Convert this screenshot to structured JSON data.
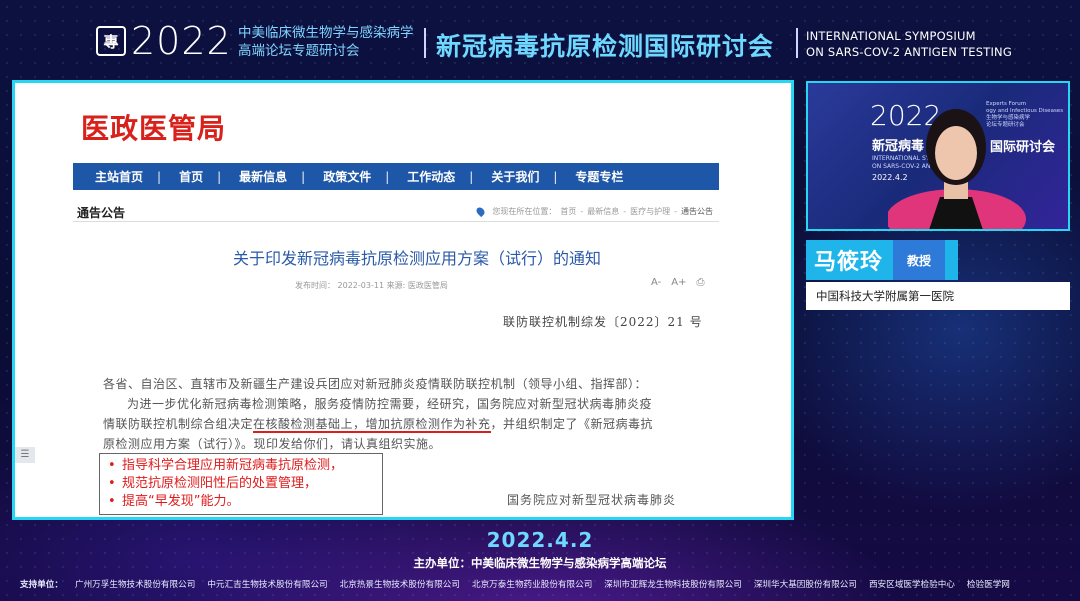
{
  "header": {
    "logo_glyph": "專",
    "year": "2022",
    "subtitle_line1": "中美临床微生物学与感染病学",
    "subtitle_line2": "高端论坛专题研讨会",
    "title": "新冠病毒抗原检测国际研讨会",
    "en_line1": "INTERNATIONAL SYMPOSIUM",
    "en_line2": "ON SARS-COV-2 ANTIGEN TESTING"
  },
  "slide": {
    "org_name": "医政医管局",
    "nav": [
      "主站首页",
      "首页",
      "最新信息",
      "政策文件",
      "工作动态",
      "关于我们",
      "专题专栏"
    ],
    "section_heading": "通告公告",
    "breadcrumb": [
      "您现在所在位置：",
      "首页",
      "最新信息",
      "医疗与护理",
      "通告公告"
    ],
    "article_title": "关于印发新冠病毒抗原检测应用方案（试行）的通知",
    "meta": "发布时间：  2022-03-11    来源: 医政医管局",
    "tools": [
      "A-",
      "A+",
      "⎙"
    ],
    "doc_number": "联防联控机制综发〔2022〕21 号",
    "para_addressee": "各省、自治区、直辖市及新疆生产建设兵团应对新冠肺炎疫情联防联控机制（领导小组、指挥部）：",
    "para_line1": "为进一步优化新冠病毒检测策略，服务疫情防控需要，经研究，国务院应对新型冠状病毒肺炎疫",
    "para_line2_pre": "情联防联控机制综合组决定",
    "para_line2_highlight": "在核酸检测基础上，增加抗原检测作为补充",
    "para_line2_post": "，并组织制定了《新冠病毒抗",
    "para_line3": "原检测应用方案（试行）》。现印发给你们，请认真组织实施。",
    "signer": "国务院应对新型冠状病毒肺炎",
    "bullets": [
      "指导科学合理应用新冠病毒抗原检测，",
      "规范抗原检测阳性后的处置管理，",
      "提高“早发现”能力。"
    ],
    "side_tab": "☰"
  },
  "video": {
    "year": "2022",
    "title_left": "新冠病毒",
    "title_right": "国际研讨会",
    "en_line1": "INTERNATIONAL SYMPOSI",
    "en_line2": "ON SARS-COV-2 ANTIGEN",
    "date": "2022.4.2",
    "small_line1": "Experts Forum",
    "small_line2": "ogy and Infectious Diseases",
    "small_line3": "生物学与感染病学",
    "small_line4": "论坛专题研讨会"
  },
  "speaker": {
    "name": "马筱玲",
    "role": "教授",
    "affiliation": "中国科技大学附属第一医院"
  },
  "footer": {
    "date": "2022.4.2",
    "host_label": "主办单位：",
    "host": "中美临床微生物学与感染病学高端论坛",
    "support_label": "支持单位：",
    "supporters": [
      "广州万孚生物技术股份有限公司",
      "中元汇吉生物技术股份有限公司",
      "北京热景生物技术股份有限公司",
      "北京万泰生物药业股份有限公司",
      "深圳市亚辉龙生物科技股份有限公司",
      "深圳华大基因股份有限公司",
      "西安区域医学检验中心",
      "检验医学网"
    ]
  },
  "colors": {
    "accent_cyan": "#27d6f2",
    "title_cyan": "#6fd8ff",
    "red": "#d9211b",
    "nav_blue": "#1f57a8"
  }
}
